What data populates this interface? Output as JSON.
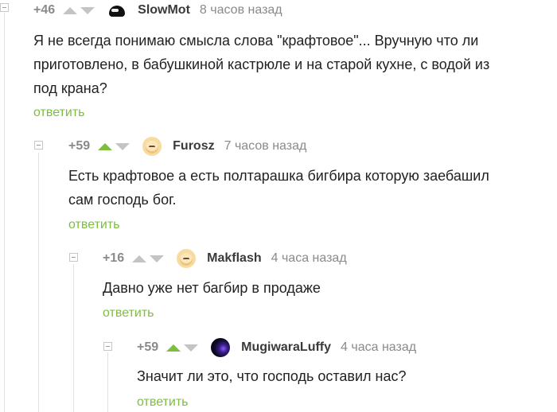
{
  "comments": [
    {
      "rating": "+46",
      "username": "SlowMot",
      "time": "8 часов назад",
      "avatar": "dark-helmet-avatar",
      "upvoted": false,
      "lines": [
        "Я не всегда понимаю смысла слова \"крафтовое\"... Вручную что ли",
        "приготовлено, в бабушкиной кастрюле и на старой кухне, с водой из",
        "под крана?"
      ],
      "reply_label": "ответить"
    },
    {
      "rating": "+59",
      "username": "Furosz",
      "time": "7 часов назад",
      "avatar": "cartoon-face-avatar",
      "upvoted": true,
      "lines": [
        "Есть крафтовое а есть полтарашка  бигбира которую заебашил",
        "сам господь бог."
      ],
      "reply_label": "ответить"
    },
    {
      "rating": "+16",
      "username": "Makflash",
      "time": "4 часа назад",
      "avatar": "cartoon-face-avatar",
      "upvoted": false,
      "lines": [
        "Давно уже нет багбир в продаже"
      ],
      "reply_label": "ответить"
    },
    {
      "rating": "+59",
      "username": "MugiwaraLuffy",
      "time": "4 часа назад",
      "avatar": "space-galaxy-avatar",
      "upvoted": true,
      "lines": [
        "Значит ли это, что господь оставил нас?"
      ],
      "reply_label": "ответить"
    }
  ],
  "colors": {
    "accent_green": "#7cbf3e",
    "muted_gray": "#8a8a8a",
    "vote_inactive": "#c4c4c4"
  }
}
